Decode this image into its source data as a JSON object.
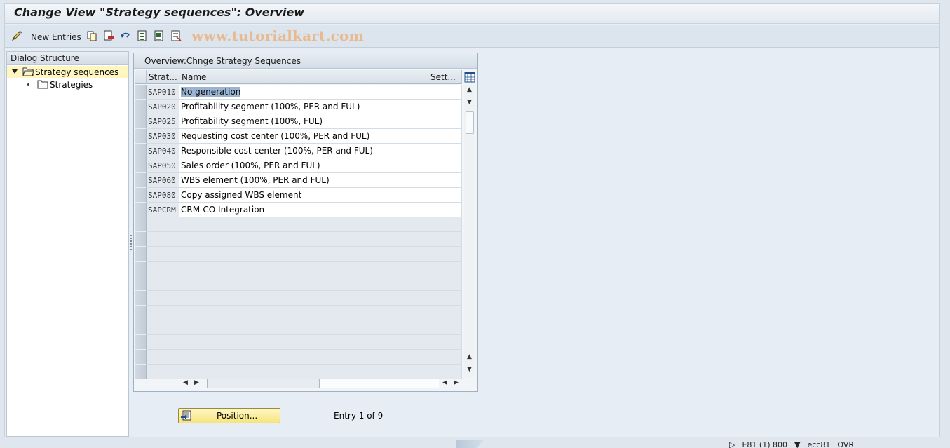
{
  "window": {
    "title": "Change View \"Strategy sequences\": Overview"
  },
  "toolbar": {
    "new_entries_label": "New Entries",
    "watermark": "www.tutorialkart.com",
    "icons": [
      "edit-pencil-icon",
      "copy-icon",
      "delete-icon",
      "undo-icon",
      "select-all-icon",
      "select-block-icon",
      "deselect-all-icon"
    ]
  },
  "dialog_structure": {
    "header": "Dialog Structure",
    "items": [
      {
        "label": "Strategy sequences",
        "expanded": true,
        "selected": true
      },
      {
        "label": "Strategies",
        "expanded": false,
        "selected": false
      }
    ]
  },
  "table": {
    "title": "Overview:Chnge Strategy Sequences",
    "columns": [
      "Strat...",
      "Name",
      "Sett..."
    ],
    "rows": [
      {
        "code": "SAP010",
        "name": "No generation"
      },
      {
        "code": "SAP020",
        "name": "Profitability segment (100%, PER and FUL)"
      },
      {
        "code": "SAP025",
        "name": "Profitability segment (100%, FUL)"
      },
      {
        "code": "SAP030",
        "name": "Requesting cost center (100%, PER and FUL)"
      },
      {
        "code": "SAP040",
        "name": "Responsible cost center (100%, PER and FUL)"
      },
      {
        "code": "SAP050",
        "name": "Sales order (100%, PER and FUL)"
      },
      {
        "code": "SAP060",
        "name": "WBS element (100%, PER and FUL)"
      },
      {
        "code": "SAP080",
        "name": "Copy assigned WBS element"
      },
      {
        "code": "SAPCRM",
        "name": "CRM-CO Integration"
      }
    ]
  },
  "footer": {
    "position_button": "Position...",
    "entry_text": "Entry 1 of 9"
  },
  "statusbar": {
    "system": "E81 (1) 800",
    "server": "ecc81",
    "mode": "OVR"
  },
  "colors": {
    "background": "#dfe6ee",
    "selected_tree": "#fff7bf",
    "highlight": "#9bb4d2",
    "position_button": "#f6e47a"
  }
}
